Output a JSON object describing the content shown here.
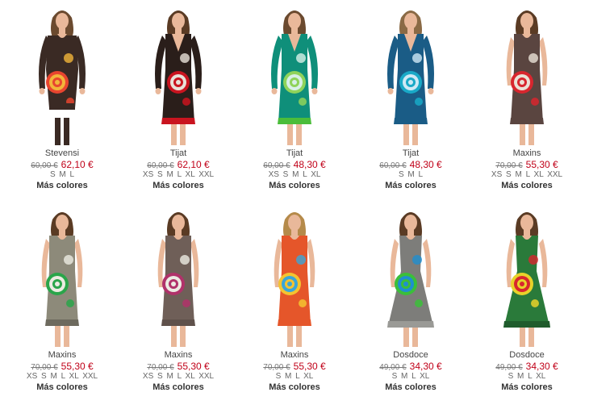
{
  "products": [
    {
      "name": "Stevensi",
      "old_price": "60,00 €",
      "new_price": "62,10 €",
      "sizes": "S M L",
      "more": "Más colores",
      "colors": {
        "dress": "#3a2a24",
        "accent": "#e8452f",
        "accent2": "#f2b53a",
        "hem": "#3a2a24",
        "skin": "#e9b89a",
        "hair": "#6b4a2f"
      }
    },
    {
      "name": "Tijat",
      "old_price": "60,00 €",
      "new_price": "62,10 €",
      "sizes": "XS S M L XL XXL",
      "more": "Más colores",
      "colors": {
        "dress": "#2a1e1a",
        "accent": "#c9141f",
        "accent2": "#e8e1d8",
        "hem": "#c9141f",
        "skin": "#e9b89a",
        "hair": "#5a3b24"
      }
    },
    {
      "name": "Tijat",
      "old_price": "60,00 €",
      "new_price": "48,30 €",
      "sizes": "XS S M L XL",
      "more": "Más colores",
      "colors": {
        "dress": "#0f8f7a",
        "accent": "#8fd35a",
        "accent2": "#d8f0e8",
        "hem": "#4bbd3a",
        "skin": "#e9b89a",
        "hair": "#6b4a2f"
      }
    },
    {
      "name": "Tijat",
      "old_price": "60,00 €",
      "new_price": "48,30 €",
      "sizes": "S M L",
      "more": "Más colores",
      "colors": {
        "dress": "#1a5c86",
        "accent": "#19a9c7",
        "accent2": "#cfe9f5",
        "hem": "#1a5c86",
        "skin": "#e9b89a",
        "hair": "#8a6a45"
      }
    },
    {
      "name": "Maxins",
      "old_price": "70,00 €",
      "new_price": "55,30 €",
      "sizes": "XS S M L XL XXL",
      "more": "Más colores",
      "colors": {
        "dress": "#5a4540",
        "accent": "#d8262e",
        "accent2": "#eae1d6",
        "hem": "#5a4540",
        "skin": "#e9b89a",
        "hair": "#5a3b24"
      }
    },
    {
      "name": "Maxins",
      "old_price": "70,00 €",
      "new_price": "55,30 €",
      "sizes": "XS S M L XL XXL",
      "more": "Más colores",
      "colors": {
        "dress": "#8d8a7a",
        "accent": "#2aa54a",
        "accent2": "#ecebe2",
        "hem": "#6d6a5e",
        "skin": "#e9b89a",
        "hair": "#5a3b24"
      }
    },
    {
      "name": "Maxins",
      "old_price": "70,00 €",
      "new_price": "55,30 €",
      "sizes": "XS S M L XL XXL",
      "more": "Más colores",
      "colors": {
        "dress": "#6f5f58",
        "accent": "#b0326a",
        "accent2": "#ecebe2",
        "hem": "#5f514b",
        "skin": "#e9b89a",
        "hair": "#5a3b24"
      }
    },
    {
      "name": "Maxins",
      "old_price": "70,00 €",
      "new_price": "55,30 €",
      "sizes": "S M L XL",
      "more": "Más colores",
      "colors": {
        "dress": "#e5562a",
        "accent": "#f4c330",
        "accent2": "#3aa6d8",
        "hem": "#e5562a",
        "skin": "#e9b89a",
        "hair": "#b58a4a"
      }
    },
    {
      "name": "Dosdoce",
      "old_price": "49,00 €",
      "new_price": "34,30 €",
      "sizes": "S M L XL",
      "more": "Más colores",
      "colors": {
        "dress": "#7d7d7a",
        "accent": "#3bbf3a",
        "accent2": "#1f8fd0",
        "hem": "#9a9a96",
        "skin": "#e9b89a",
        "hair": "#5a3b24"
      }
    },
    {
      "name": "Dosdoce",
      "old_price": "49,00 €",
      "new_price": "34,30 €",
      "sizes": "S M L XL",
      "more": "Más colores",
      "colors": {
        "dress": "#2a7a3a",
        "accent": "#e8d22a",
        "accent2": "#d8262e",
        "hem": "#1f5c2c",
        "skin": "#e9b89a",
        "hair": "#5a3b24"
      }
    }
  ]
}
